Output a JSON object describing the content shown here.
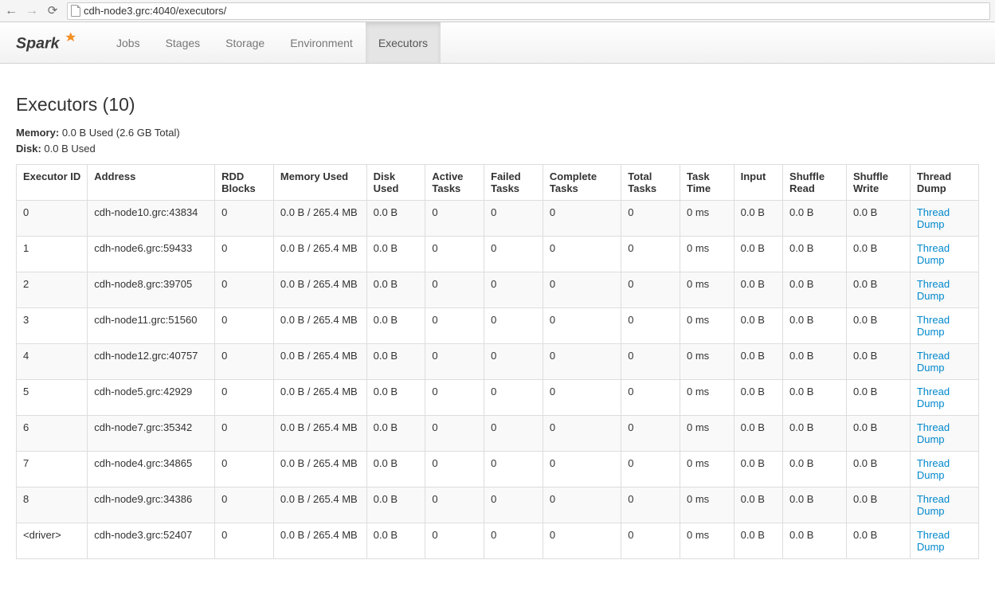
{
  "browser": {
    "url": "cdh-node3.grc:4040/executors/"
  },
  "nav": {
    "items": [
      {
        "label": "Jobs"
      },
      {
        "label": "Stages"
      },
      {
        "label": "Storage"
      },
      {
        "label": "Environment"
      },
      {
        "label": "Executors",
        "active": true
      }
    ]
  },
  "page": {
    "title": "Executors (10)",
    "memory_label": "Memory:",
    "memory_value": "0.0 B Used (2.6 GB Total)",
    "disk_label": "Disk:",
    "disk_value": "0.0 B Used"
  },
  "table": {
    "headers": [
      "Executor ID",
      "Address",
      "RDD Blocks",
      "Memory Used",
      "Disk Used",
      "Active Tasks",
      "Failed Tasks",
      "Complete Tasks",
      "Total Tasks",
      "Task Time",
      "Input",
      "Shuffle Read",
      "Shuffle Write",
      "Thread Dump"
    ],
    "thread_dump_label": "Thread Dump",
    "rows": [
      {
        "id": "0",
        "address": "cdh-node10.grc:43834",
        "rdd": "0",
        "mem": "0.0 B / 265.4 MB",
        "disk": "0.0 B",
        "active": "0",
        "failed": "0",
        "complete": "0",
        "total": "0",
        "time": "0 ms",
        "input": "0.0 B",
        "sread": "0.0 B",
        "swrite": "0.0 B"
      },
      {
        "id": "1",
        "address": "cdh-node6.grc:59433",
        "rdd": "0",
        "mem": "0.0 B / 265.4 MB",
        "disk": "0.0 B",
        "active": "0",
        "failed": "0",
        "complete": "0",
        "total": "0",
        "time": "0 ms",
        "input": "0.0 B",
        "sread": "0.0 B",
        "swrite": "0.0 B"
      },
      {
        "id": "2",
        "address": "cdh-node8.grc:39705",
        "rdd": "0",
        "mem": "0.0 B / 265.4 MB",
        "disk": "0.0 B",
        "active": "0",
        "failed": "0",
        "complete": "0",
        "total": "0",
        "time": "0 ms",
        "input": "0.0 B",
        "sread": "0.0 B",
        "swrite": "0.0 B"
      },
      {
        "id": "3",
        "address": "cdh-node11.grc:51560",
        "rdd": "0",
        "mem": "0.0 B / 265.4 MB",
        "disk": "0.0 B",
        "active": "0",
        "failed": "0",
        "complete": "0",
        "total": "0",
        "time": "0 ms",
        "input": "0.0 B",
        "sread": "0.0 B",
        "swrite": "0.0 B"
      },
      {
        "id": "4",
        "address": "cdh-node12.grc:40757",
        "rdd": "0",
        "mem": "0.0 B / 265.4 MB",
        "disk": "0.0 B",
        "active": "0",
        "failed": "0",
        "complete": "0",
        "total": "0",
        "time": "0 ms",
        "input": "0.0 B",
        "sread": "0.0 B",
        "swrite": "0.0 B"
      },
      {
        "id": "5",
        "address": "cdh-node5.grc:42929",
        "rdd": "0",
        "mem": "0.0 B / 265.4 MB",
        "disk": "0.0 B",
        "active": "0",
        "failed": "0",
        "complete": "0",
        "total": "0",
        "time": "0 ms",
        "input": "0.0 B",
        "sread": "0.0 B",
        "swrite": "0.0 B"
      },
      {
        "id": "6",
        "address": "cdh-node7.grc:35342",
        "rdd": "0",
        "mem": "0.0 B / 265.4 MB",
        "disk": "0.0 B",
        "active": "0",
        "failed": "0",
        "complete": "0",
        "total": "0",
        "time": "0 ms",
        "input": "0.0 B",
        "sread": "0.0 B",
        "swrite": "0.0 B"
      },
      {
        "id": "7",
        "address": "cdh-node4.grc:34865",
        "rdd": "0",
        "mem": "0.0 B / 265.4 MB",
        "disk": "0.0 B",
        "active": "0",
        "failed": "0",
        "complete": "0",
        "total": "0",
        "time": "0 ms",
        "input": "0.0 B",
        "sread": "0.0 B",
        "swrite": "0.0 B"
      },
      {
        "id": "8",
        "address": "cdh-node9.grc:34386",
        "rdd": "0",
        "mem": "0.0 B / 265.4 MB",
        "disk": "0.0 B",
        "active": "0",
        "failed": "0",
        "complete": "0",
        "total": "0",
        "time": "0 ms",
        "input": "0.0 B",
        "sread": "0.0 B",
        "swrite": "0.0 B"
      },
      {
        "id": "<driver>",
        "address": "cdh-node3.grc:52407",
        "rdd": "0",
        "mem": "0.0 B / 265.4 MB",
        "disk": "0.0 B",
        "active": "0",
        "failed": "0",
        "complete": "0",
        "total": "0",
        "time": "0 ms",
        "input": "0.0 B",
        "sread": "0.0 B",
        "swrite": "0.0 B"
      }
    ]
  }
}
